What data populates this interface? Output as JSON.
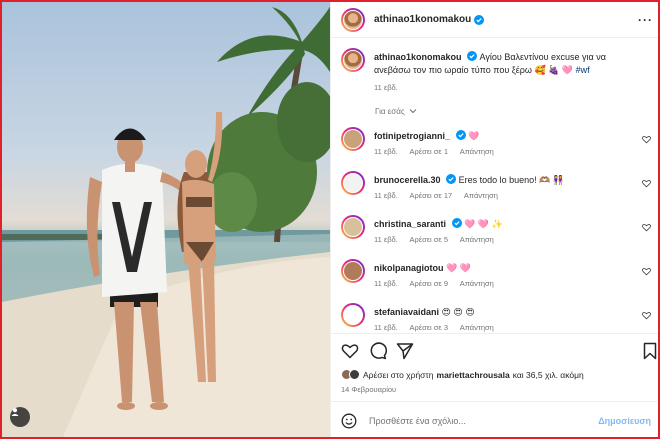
{
  "post": {
    "username": "athinao1konomakou",
    "caption_text": "Αγίου Βαλεντίνου excuse για να ανεβάσω τον πιο ωραίο τύπο που ξέρω 🥰 🍇 🩷",
    "caption_hashtag": "#wf",
    "caption_time": "11 εβδ.",
    "for_you_label": "Για εσάς"
  },
  "comments": [
    {
      "username": "fotinipetrogianni_",
      "text": "🩷",
      "time": "11 εβδ.",
      "likes": "Αρέσει σε 1",
      "reply": "Απάντηση",
      "avatar_color": "#c9a27a"
    },
    {
      "username": "brunocerella.30",
      "text": "Eres todo lo bueno! 🫶🏽 👭",
      "time": "11 εβδ.",
      "likes": "Αρέσει σε 17",
      "reply": "Απάντηση",
      "avatar_color": "#f2f2f2"
    },
    {
      "username": "christina_saranti",
      "text": "🩷 🩷 ✨",
      "time": "11 εβδ.",
      "likes": "Αρέσει σε 5",
      "reply": "Απάντηση",
      "avatar_color": "#d7c19a"
    },
    {
      "username": "nikolpanagiotou",
      "text": "🩷 🩷",
      "time": "11 εβδ.",
      "likes": "Αρέσει σε 9",
      "reply": "Απάντηση",
      "avatar_color": "#b07b5a"
    },
    {
      "username": "stefaniavaidani",
      "text": "😍 😍 😍",
      "time": "11 εβδ.",
      "likes": "Αρέσει σε 3",
      "reply": "Απάντηση",
      "avatar_color": "#ffffff"
    }
  ],
  "likes_line": {
    "prefix": "Αρέσει στο χρήστη",
    "user": "mariettachrousala",
    "suffix": "και 36,5 χιλ. ακόμη"
  },
  "date": "14 Φεβρουαρίου",
  "comment_box": {
    "placeholder": "Προσθέστε ένα σχόλιο...",
    "post_label": "Δημοσίευση"
  },
  "colors": {
    "frame": "#e0202a",
    "verified": "#0095f6",
    "link": "#00376b",
    "heart": "#ed1f5a",
    "post": "#7fbcf4"
  },
  "icons": [
    "verified-icon",
    "more-icon",
    "heart-icon",
    "comment-icon",
    "share-icon",
    "bookmark-icon",
    "emoji-icon",
    "user-tag-icon",
    "chevron-down-icon"
  ]
}
